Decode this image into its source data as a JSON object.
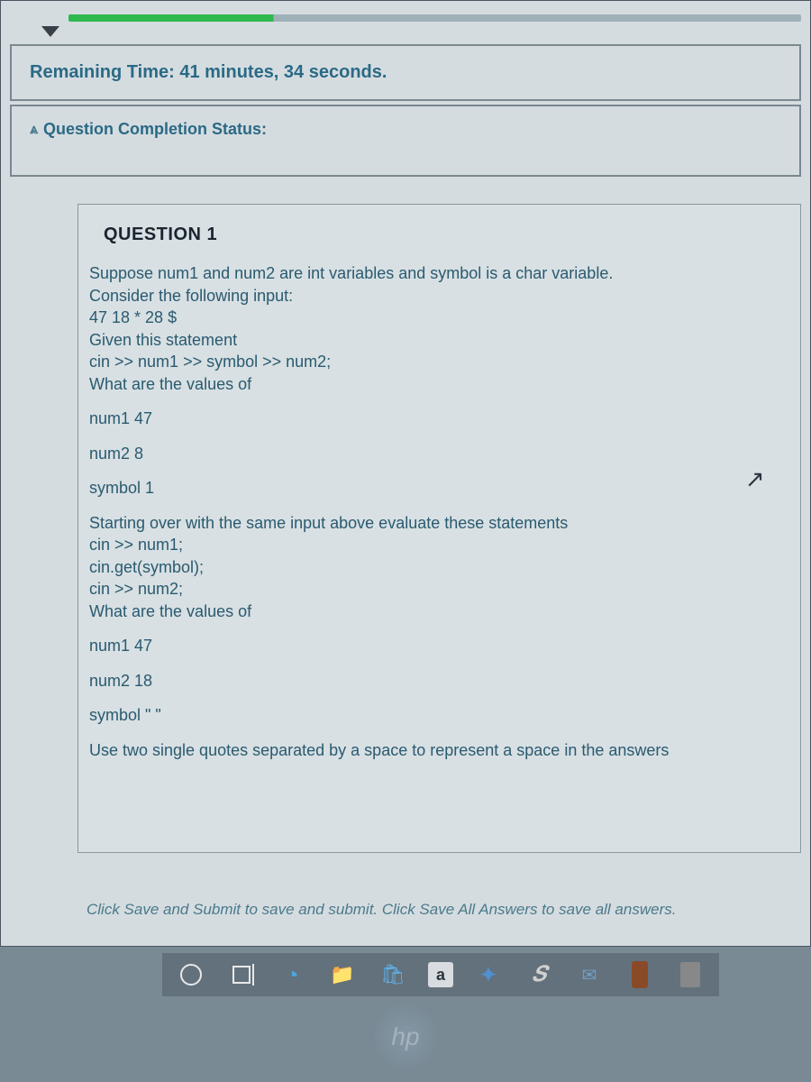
{
  "timer": {
    "label": "Remaining Time: 41 minutes, 34 seconds."
  },
  "status": {
    "label": "Question Completion Status:"
  },
  "question": {
    "title": "QUESTION 1",
    "lines": {
      "l1": "Suppose num1 and num2 are int variables and symbol is a char variable.",
      "l2": "Consider the following input:",
      "l3": "47 18 * 28 $",
      "l4": "Given this statement",
      "l5": "cin >> num1 >> symbol >> num2;",
      "l6": "What are the values of",
      "l7": "num1  47",
      "l8": "num2  8",
      "l9": "symbol  1",
      "l10": "Starting over with the same input above evaluate these statements",
      "l11": "cin >> num1;",
      "l12": "cin.get(symbol);",
      "l13": "cin >> num2;",
      "l14": "What are the values of",
      "l15": "num1  47",
      "l16": "num2  18",
      "l17": "symbol  \" \"",
      "l18": "Use two single quotes separated by a space to represent a space in the answers"
    }
  },
  "footer_instruction": "Click Save and Submit to save and submit. Click Save All Answers to save all answers.",
  "hp": "hp"
}
